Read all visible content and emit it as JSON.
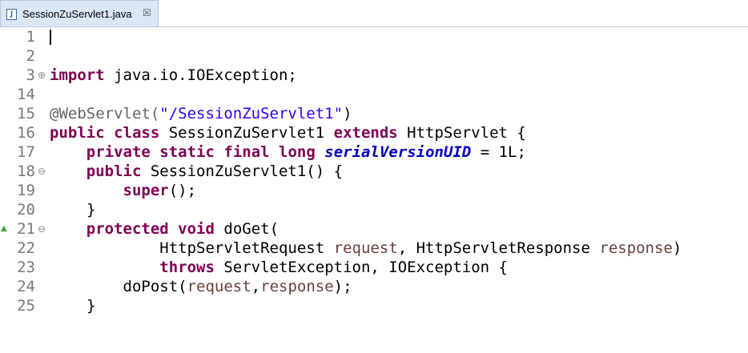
{
  "tab": {
    "file_icon": "java-file-icon",
    "file_icon_glyph": "J",
    "title": "SessionZuServlet1.java",
    "close_glyph": "☒"
  },
  "lines": [
    {
      "num": "1",
      "text": ""
    },
    {
      "num": "2",
      "text": ""
    },
    {
      "num": "3",
      "kw": "import",
      "rest": " java.io.IOException;"
    },
    {
      "num": "14",
      "text": ""
    },
    {
      "num": "15",
      "ann": "@WebServlet(",
      "str": "\"/SessionZuServlet1\"",
      "close": ")"
    },
    {
      "num": "16",
      "kw1": "public",
      "kw2": "class",
      "mid": " SessionZuServlet1 ",
      "kw3": "extends",
      "rest": " HttpServlet {"
    },
    {
      "num": "17",
      "kw1": "private",
      "kw2": "static",
      "kw3": "final",
      "kw4": "long",
      "field": "serialVersionUID",
      "rest": " = 1L;"
    },
    {
      "num": "18",
      "kw": "public",
      "rest": " SessionZuServlet1() {"
    },
    {
      "num": "19",
      "kw": "super",
      "rest": "();"
    },
    {
      "num": "20",
      "text": "}"
    },
    {
      "num": "21",
      "kw1": "protected",
      "kw2": "void",
      "rest": " doGet("
    },
    {
      "num": "22",
      "t1": "HttpServletRequest ",
      "p1": "request",
      "t2": ", HttpServletResponse ",
      "p2": "response",
      "t3": ")"
    },
    {
      "num": "23",
      "kw": "throws",
      "rest": " ServletException, IOException {"
    },
    {
      "num": "24",
      "t1": "doPost(",
      "p1": "request",
      "t2": ",",
      "p2": "response",
      "t3": ");"
    },
    {
      "num": "25",
      "text": "}"
    }
  ],
  "gutter": {
    "fold_expand": "⊕",
    "fold_collapse": "⊖",
    "override_marker": "▲"
  }
}
